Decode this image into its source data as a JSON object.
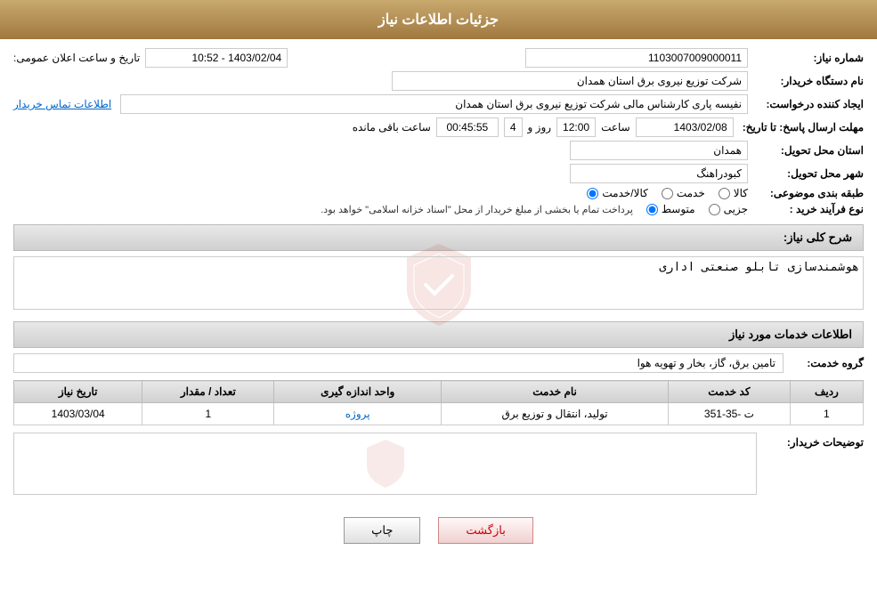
{
  "header": {
    "title": "جزئیات اطلاعات نیاز"
  },
  "fields": {
    "shomareNiaz_label": "شماره نیاز:",
    "shomareNiaz_value": "1103007009000011",
    "namDastgah_label": "نام دستگاه خریدار:",
    "namDastgah_value": "شرکت توزیع نیروی برق استان همدان",
    "ijadKonande_label": "ایجاد کننده درخواست:",
    "ijadKonande_value": "نفیسه پاری کارشناس مالی شرکت توزیع نیروی برق استان همدان",
    "ijadKonande_link": "اطلاعات تماس خریدار",
    "mohlatErsal_label": "مهلت ارسال پاسخ: تا تاریخ:",
    "tarikh_value": "1403/02/08",
    "saat_label": "ساعت",
    "saat_value": "12:00",
    "rooz_label": "روز و",
    "rooz_value": "4",
    "baghimande_label": "ساعت باقی مانده",
    "countdown_value": "00:45:55",
    "tarikh_va_saat_label": "تاریخ و ساعت اعلان عمومی:",
    "tarikh_va_saat_value": "1403/02/04 - 10:52",
    "ostanTahvil_label": "استان محل تحویل:",
    "ostanTahvil_value": "همدان",
    "shahrTahvil_label": "شهر محل تحویل:",
    "shahrTahvil_value": "کبودراهنگ",
    "tabaqeBandi_label": "طبقه بندی موضوعی:",
    "kala_label": "کالا",
    "khedmat_label": "خدمت",
    "kala_khedmat_label": "کالا/خدمت",
    "navFarayand_label": "نوع فرآیند خرید :",
    "jazii_label": "جزیی",
    "motevasset_label": "متوسط",
    "farayand_note": "پرداخت تمام یا بخشی از مبلغ خریدار از محل \"اسناد خزانه اسلامی\" خواهد بود.",
    "sharhKolli_label": "شرح کلی نیاز:",
    "sharhKolli_value": "هوشمندسازی تابلو صنعتی اداری",
    "khadamatInfo_title": "اطلاعات خدمات مورد نیاز",
    "groheKhedmat_label": "گروه خدمت:",
    "groheKhedmat_value": "تامین برق، گاز، بخار و تهویه هوا",
    "table": {
      "headers": [
        "ردیف",
        "کد خدمت",
        "نام خدمت",
        "واحد اندازه گیری",
        "تعداد / مقدار",
        "تاریخ نیاز"
      ],
      "rows": [
        {
          "radif": "1",
          "kodKhedmat": "ت -35-351",
          "namKhedmat": "تولید، انتقال و توزیع برق",
          "vahedAndaze": "پروژه",
          "tedad": "1",
          "tarikhNiaz": "1403/03/04"
        }
      ]
    },
    "tosifat_label": "توضیحات خریدار:",
    "tosifat_value": ""
  },
  "buttons": {
    "print": "چاپ",
    "back": "بازگشت"
  }
}
